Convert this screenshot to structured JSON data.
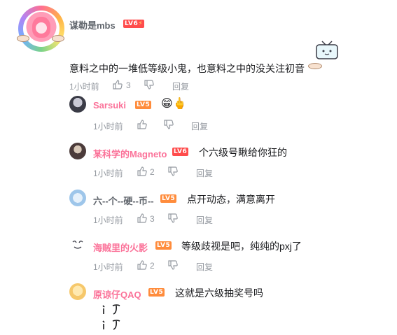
{
  "main_comment": {
    "username": "谋勒是mbs",
    "level": "LV6",
    "text": "意料之中的一堆低等级小鬼，也意料之中的没关注初音",
    "time": "1小时前",
    "likes": "3",
    "reply_label": "回复"
  },
  "replies": [
    {
      "username": "Sarsuki",
      "level": "LV5",
      "text": "😁🖕",
      "time": "1小时前",
      "likes": "",
      "reply_label": "回复"
    },
    {
      "username": "某科学的Magneto",
      "level": "LV6",
      "text": "个六级号瞅给你狂的",
      "time": "1小时前",
      "likes": "2",
      "reply_label": "回复"
    },
    {
      "username": "六--个--硬--币--",
      "level": "LV5",
      "text": "点开动态，满意离开",
      "time": "1小时前",
      "likes": "3",
      "reply_label": "回复"
    },
    {
      "username": "海贼里的火影",
      "level": "LV5",
      "text": "等级歧视是吧，纯纯的pxj了",
      "time": "1小时前",
      "likes": "2",
      "reply_label": "回复"
    },
    {
      "username": "原谅仔QAQ",
      "level": "LV5",
      "text": "这就是六级抽奖号吗",
      "time": "",
      "likes": "",
      "reply_label": ""
    }
  ],
  "colors": {
    "username_main": "#61666d",
    "username_reply": "#fb7299",
    "meta": "#9499a0",
    "lv6": "#ff4c4c",
    "lv5": "#ff8c3c"
  },
  "icons": [
    "like-icon",
    "dislike-icon",
    "tv-sticker-icon",
    "hand-drawn-sticker-icon"
  ]
}
